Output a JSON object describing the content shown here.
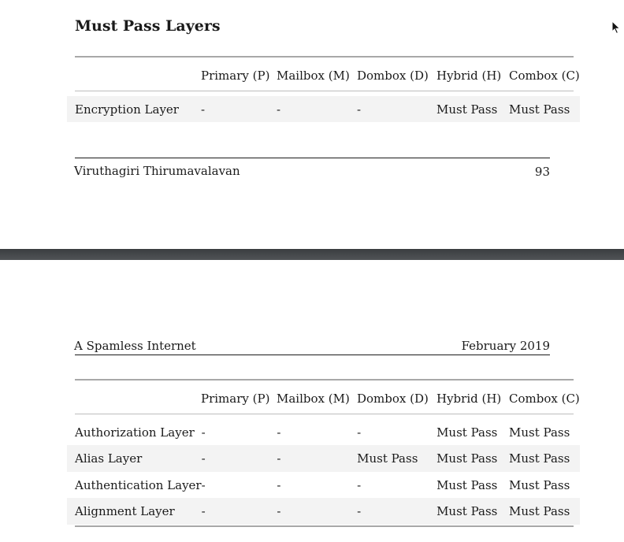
{
  "page_top": {
    "section_title": "Must Pass Layers",
    "columns": [
      "",
      "Primary (P)",
      "Mailbox (M)",
      "Dombox (D)",
      "Hybrid (H)",
      "Combox (C)"
    ],
    "rows": [
      [
        "Encryption Layer",
        "-",
        "-",
        "-",
        "Must Pass",
        "Must Pass"
      ]
    ],
    "footer": {
      "author": "Viruthagiri Thirumavalavan",
      "page_number": "93"
    }
  },
  "page_bottom": {
    "header": {
      "title": "A Spamless Internet",
      "date": "February 2019"
    },
    "columns": [
      "",
      "Primary (P)",
      "Mailbox (M)",
      "Dombox (D)",
      "Hybrid (H)",
      "Combox (C)"
    ],
    "rows": [
      [
        "Authorization Layer",
        "-",
        "-",
        "-",
        "Must Pass",
        "Must Pass"
      ],
      [
        "Alias Layer",
        "-",
        "-",
        "Must Pass",
        "Must Pass",
        "Must Pass"
      ],
      [
        "Authentication Layer",
        "-",
        "-",
        "-",
        "Must Pass",
        "Must Pass"
      ],
      [
        "Alignment Layer",
        "-",
        "-",
        "-",
        "Must Pass",
        "Must Pass"
      ]
    ]
  },
  "icons": {
    "cursor": "mouse-pointer-icon"
  }
}
